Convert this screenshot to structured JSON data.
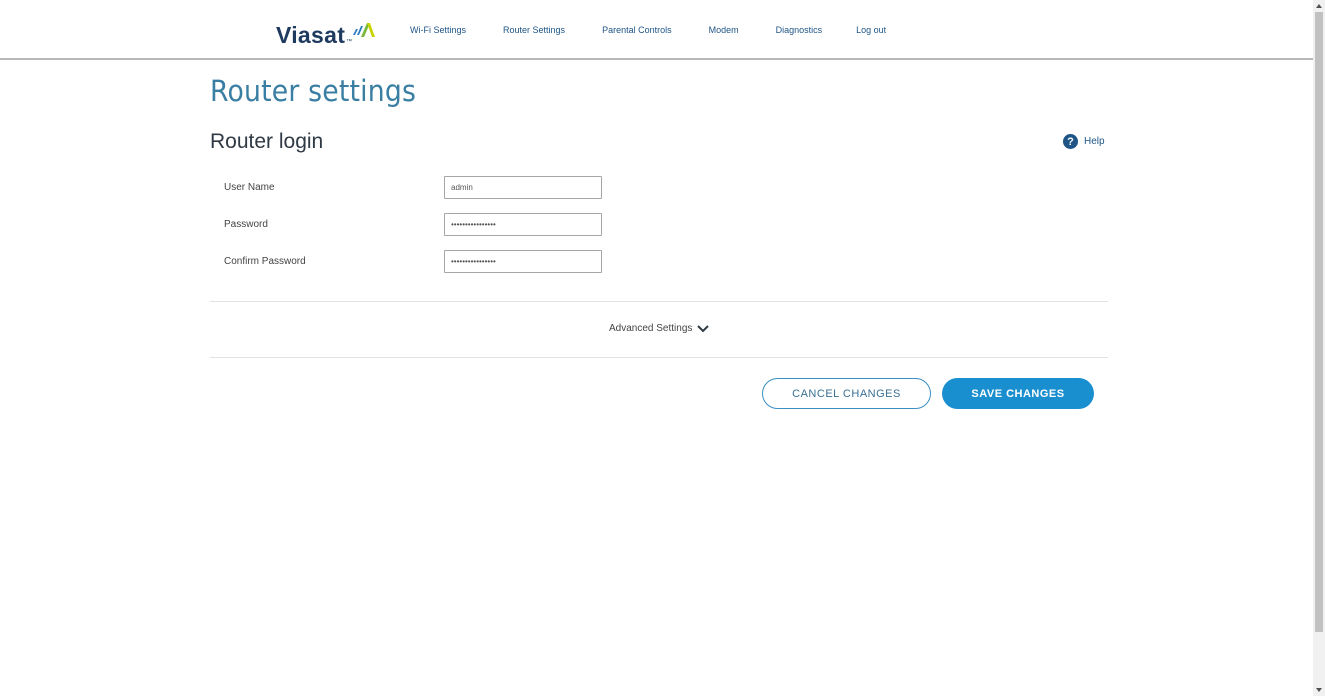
{
  "brand": {
    "name": "Viasat",
    "trademark": "™",
    "mark_colors": [
      "#2f7fc1",
      "#7ab83c",
      "#c8d400"
    ]
  },
  "nav": {
    "items": [
      {
        "label": "Wi-Fi Settings"
      },
      {
        "label": "Router Settings"
      },
      {
        "label": "Parental Controls"
      },
      {
        "label": "Modem"
      },
      {
        "label": "Diagnostics"
      },
      {
        "label": "Log out"
      }
    ]
  },
  "page": {
    "title": "Router settings"
  },
  "section": {
    "title": "Router login",
    "help_label": "Help",
    "help_icon": "question-circle-icon"
  },
  "form": {
    "username": {
      "label": "User Name",
      "value": "admin"
    },
    "password": {
      "label": "Password",
      "value": "••••••••••••••••"
    },
    "confirm_password": {
      "label": "Confirm Password",
      "value": "••••••••••••••••"
    }
  },
  "advanced": {
    "label": "Advanced Settings",
    "icon": "chevron-down-icon"
  },
  "actions": {
    "cancel_label": "CANCEL CHANGES",
    "save_label": "SAVE CHANGES"
  },
  "colors": {
    "accent": "#1a8fd0",
    "title": "#3a7fa3",
    "nav": "#1e5486"
  }
}
